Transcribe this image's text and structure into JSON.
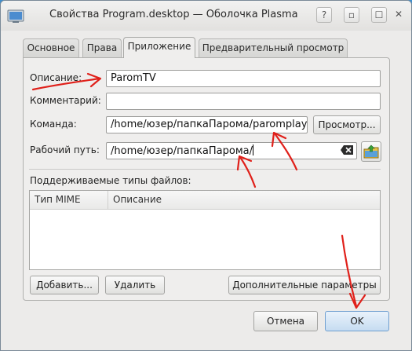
{
  "window": {
    "title": "Свойства Program.desktop — Оболочка Plasma"
  },
  "tabs": [
    {
      "label": "Основное"
    },
    {
      "label": "Права"
    },
    {
      "label": "Приложение"
    },
    {
      "label": "Предварительный просмотр"
    }
  ],
  "form": {
    "description_label": "Описание:",
    "description_value": "ParomTV",
    "comment_label": "Комментарий:",
    "comment_value": "",
    "command_label": "Команда:",
    "command_value": "/home/юзер/папкаПарома/paromplayer",
    "browse_label": "Просмотр...",
    "workdir_label": "Рабочий путь:",
    "workdir_value": "/home/юзер/папкаПарома/"
  },
  "mime": {
    "section_label": "Поддерживаемые типы файлов:",
    "columns": [
      "Тип MIME",
      "Описание"
    ],
    "add_label": "Добавить...",
    "remove_label": "Удалить",
    "advanced_label": "Дополнительные параметры"
  },
  "dialog": {
    "cancel_label": "Отмена",
    "ok_label": "OK"
  },
  "colors": {
    "annotation": "#e0201a",
    "accent": "#6f9fd0"
  }
}
